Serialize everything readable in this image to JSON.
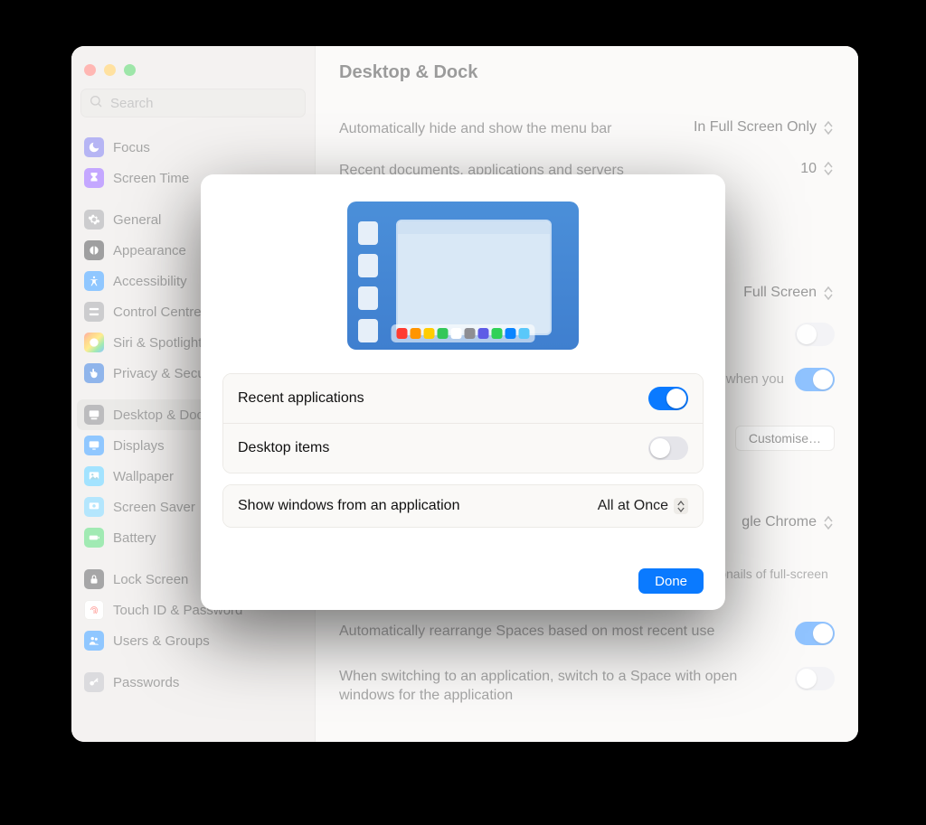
{
  "window": {
    "traffic_lights": {
      "close": "#ff5f57",
      "min": "#febc2e",
      "max": "#28c840"
    },
    "search_placeholder": "Search"
  },
  "sidebar": {
    "items": [
      {
        "label": "Focus",
        "icon": "moon-icon",
        "ic_class": "ic-purple"
      },
      {
        "label": "Screen Time",
        "icon": "hourglass-icon",
        "ic_class": "ic-violet"
      },
      {
        "label": "General",
        "icon": "gear-icon",
        "ic_class": "ic-gray",
        "section_start": true
      },
      {
        "label": "Appearance",
        "icon": "appearance-icon",
        "ic_class": "ic-black"
      },
      {
        "label": "Accessibility",
        "icon": "accessibility-icon",
        "ic_class": "ic-blue"
      },
      {
        "label": "Control Centre",
        "icon": "switches-icon",
        "ic_class": "ic-gray"
      },
      {
        "label": "Siri & Spotlight",
        "icon": "siri-icon",
        "ic_class": "ic-multi"
      },
      {
        "label": "Privacy & Security",
        "icon": "hand-icon",
        "ic_class": "ic-hand"
      },
      {
        "label": "Desktop & Dock",
        "icon": "dock-icon",
        "ic_class": "ic-desk",
        "section_start": true,
        "selected": true
      },
      {
        "label": "Displays",
        "icon": "display-icon",
        "ic_class": "ic-display"
      },
      {
        "label": "Wallpaper",
        "icon": "wallpaper-icon",
        "ic_class": "ic-wall"
      },
      {
        "label": "Screen Saver",
        "icon": "screensaver-icon",
        "ic_class": "ic-saver"
      },
      {
        "label": "Battery",
        "icon": "battery-icon",
        "ic_class": "ic-batt"
      },
      {
        "label": "Lock Screen",
        "icon": "lock-icon",
        "ic_class": "ic-lock",
        "section_start": true
      },
      {
        "label": "Touch ID & Password",
        "icon": "fingerprint-icon",
        "ic_class": "ic-touch"
      },
      {
        "label": "Users & Groups",
        "icon": "users-icon",
        "ic_class": "ic-users"
      },
      {
        "label": "Passwords",
        "icon": "key-icon",
        "ic_class": "ic-pass",
        "section_start": true
      }
    ]
  },
  "content": {
    "title": "Desktop & Dock",
    "rows": {
      "menu_bar": {
        "label": "Automatically hide and show the menu bar",
        "value": "In Full Screen Only"
      },
      "recents_count": {
        "label": "Recent documents, applications and servers",
        "value": "10"
      },
      "full_screen": {
        "label": "",
        "value": "Full Screen"
      },
      "toggle_a": {
        "label": "",
        "on": false
      },
      "toggle_b": {
        "label": "",
        "on": true,
        "sub": "when you"
      },
      "customise": {
        "label": "Customise…"
      },
      "chrome": {
        "value": "gle Chrome"
      },
      "mission_control_desc": "Mission Control shows an overview of your open windows and thumbnails of full-screen applications, all arranged in a unified view.",
      "auto_rearrange": {
        "label": "Automatically rearrange Spaces based on most recent use",
        "on": true
      },
      "switch_space": {
        "label": "When switching to an application, switch to a Space with open windows for the application",
        "on": false
      }
    }
  },
  "sheet": {
    "rows": {
      "recent_apps": {
        "label": "Recent applications",
        "on": true
      },
      "desktop_items": {
        "label": "Desktop items",
        "on": false
      },
      "show_windows": {
        "label": "Show windows from an application",
        "value": "All at Once"
      }
    },
    "done": "Done",
    "dock_colors": [
      "#ff3b30",
      "#ff9500",
      "#ffcc00",
      "#34c759",
      "#ffffff",
      "#8e8e93",
      "#5e5ce6",
      "#30d158",
      "#0a84ff",
      "#5ac8fa"
    ]
  }
}
